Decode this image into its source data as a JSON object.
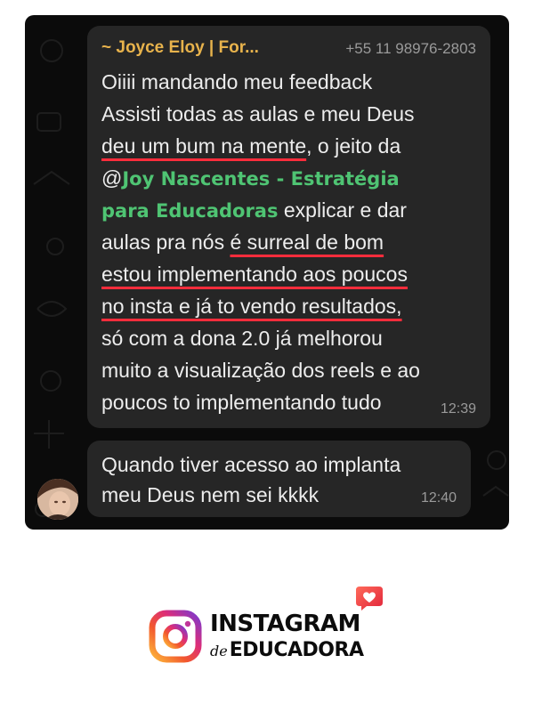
{
  "message1": {
    "sender_name": "~ Joyce Eloy | For...",
    "sender_phone": "+55 11 98976-2803",
    "lines": [
      "Oiiii mandando meu feedback",
      "Assisti todas as aulas e meu Deus",
      "deu um bum na mente",
      ", o jeito da",
      "@",
      "Joy Nascentes - Estratégia",
      "para Educadoras",
      " explicar e dar",
      "aulas pra nós ",
      "é surreal de bom",
      "estou implementando aos poucos",
      "no insta e já to vendo resultados,",
      "só com a dona 2.0 já melhorou",
      "muito a visualização dos reels e ao",
      "poucos to implementando tudo"
    ],
    "time": "12:39"
  },
  "message2": {
    "lines": [
      "Quando tiver acesso ao implanta",
      "meu Deus nem sei kkkk"
    ],
    "time": "12:40"
  },
  "logo": {
    "title": "INSTAGRAM",
    "sub_prefix": "de",
    "sub_main": "EDUCADORA"
  },
  "colors": {
    "chat_background": "#0b0b0b",
    "bubble": "#262626",
    "sender_name": "#e8b34c",
    "mention": "#4fc473",
    "underline": "#ff2d3c"
  }
}
